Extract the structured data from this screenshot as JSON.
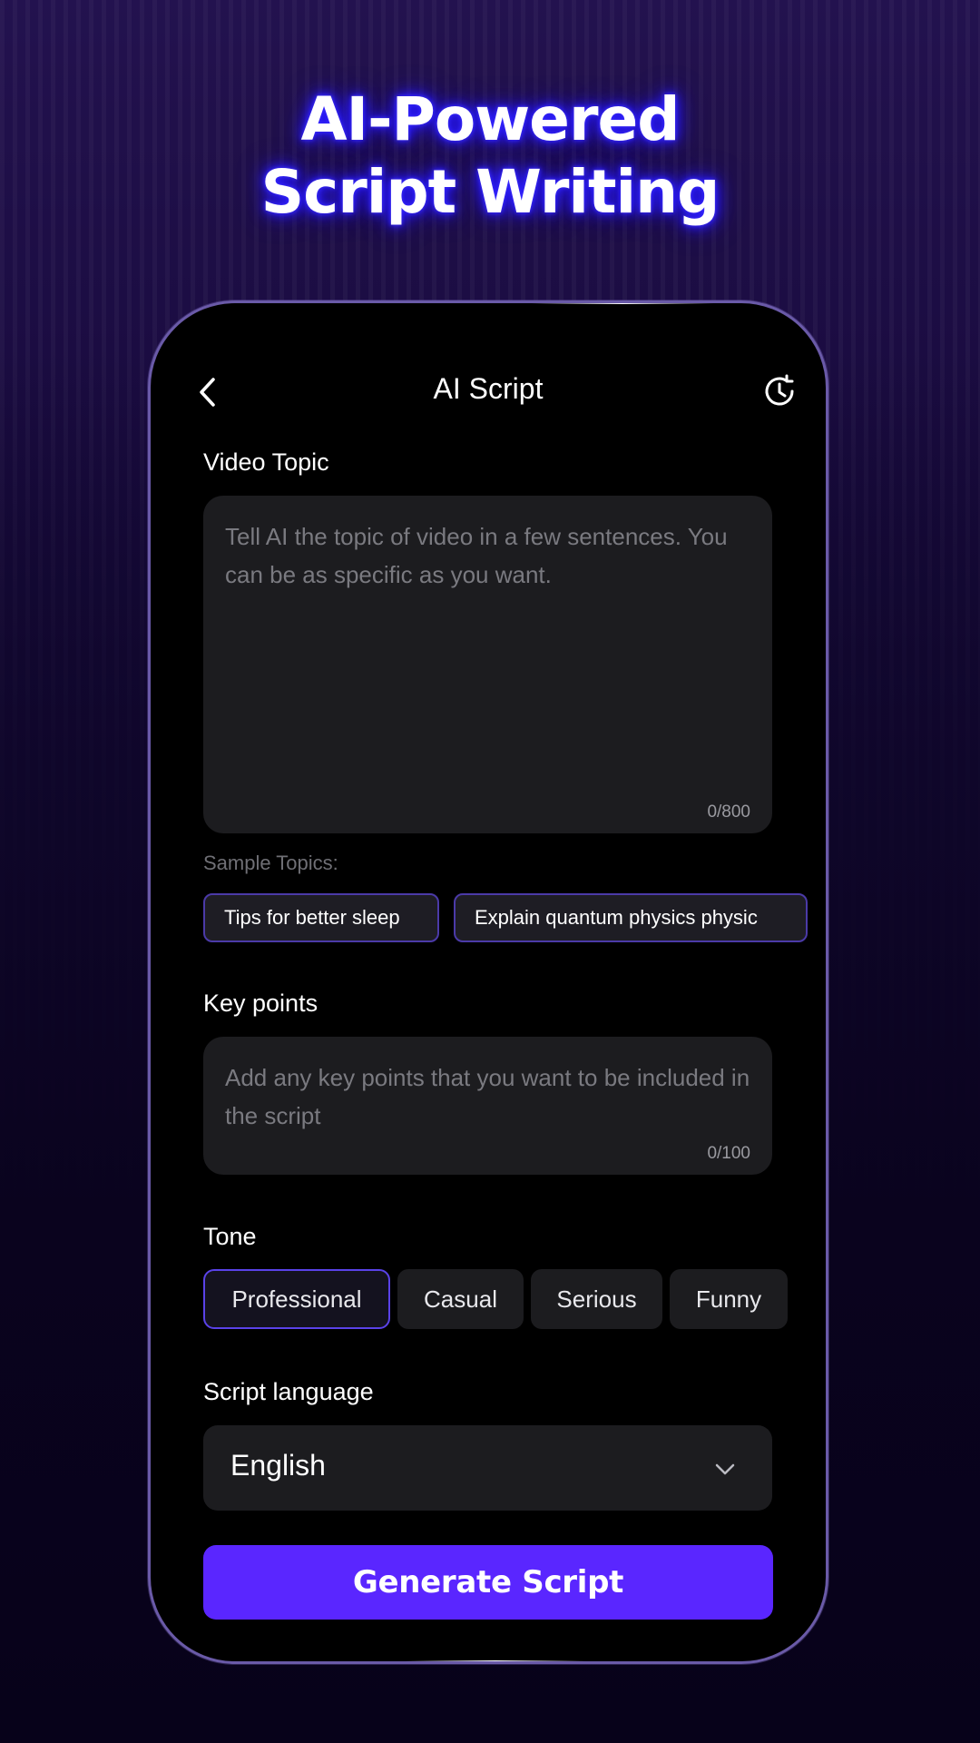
{
  "headline": {
    "line1": "AI-Powered",
    "line2": "Script Writing"
  },
  "topbar": {
    "title": "AI Script",
    "back_icon": "chevron-left-icon",
    "history_icon": "history-clock-icon"
  },
  "video_topic": {
    "label": "Video Topic",
    "placeholder": "Tell AI the topic of video in a few sentences. You can be as specific as you want.",
    "counter": "0/800"
  },
  "sample_topics": {
    "label": "Sample Topics:",
    "chips": [
      "Tips for better sleep",
      "Explain quantum physics physic"
    ]
  },
  "key_points": {
    "label": "Key points",
    "placeholder": "Add any key points that you want to be included in the script",
    "counter": "0/100"
  },
  "tone": {
    "label": "Tone",
    "options": [
      "Professional",
      "Casual",
      "Serious",
      "Funny"
    ],
    "selected": "Professional"
  },
  "script_language": {
    "label": "Script language",
    "value": "English",
    "icon": "chevron-down-icon"
  },
  "generate_button": {
    "label": "Generate Script"
  },
  "colors": {
    "accent": "#5a26ff",
    "chip_border": "#4b3aa8",
    "field_bg": "#1c1c1f",
    "background_top": "#23124f",
    "background_bottom": "#07021a"
  }
}
